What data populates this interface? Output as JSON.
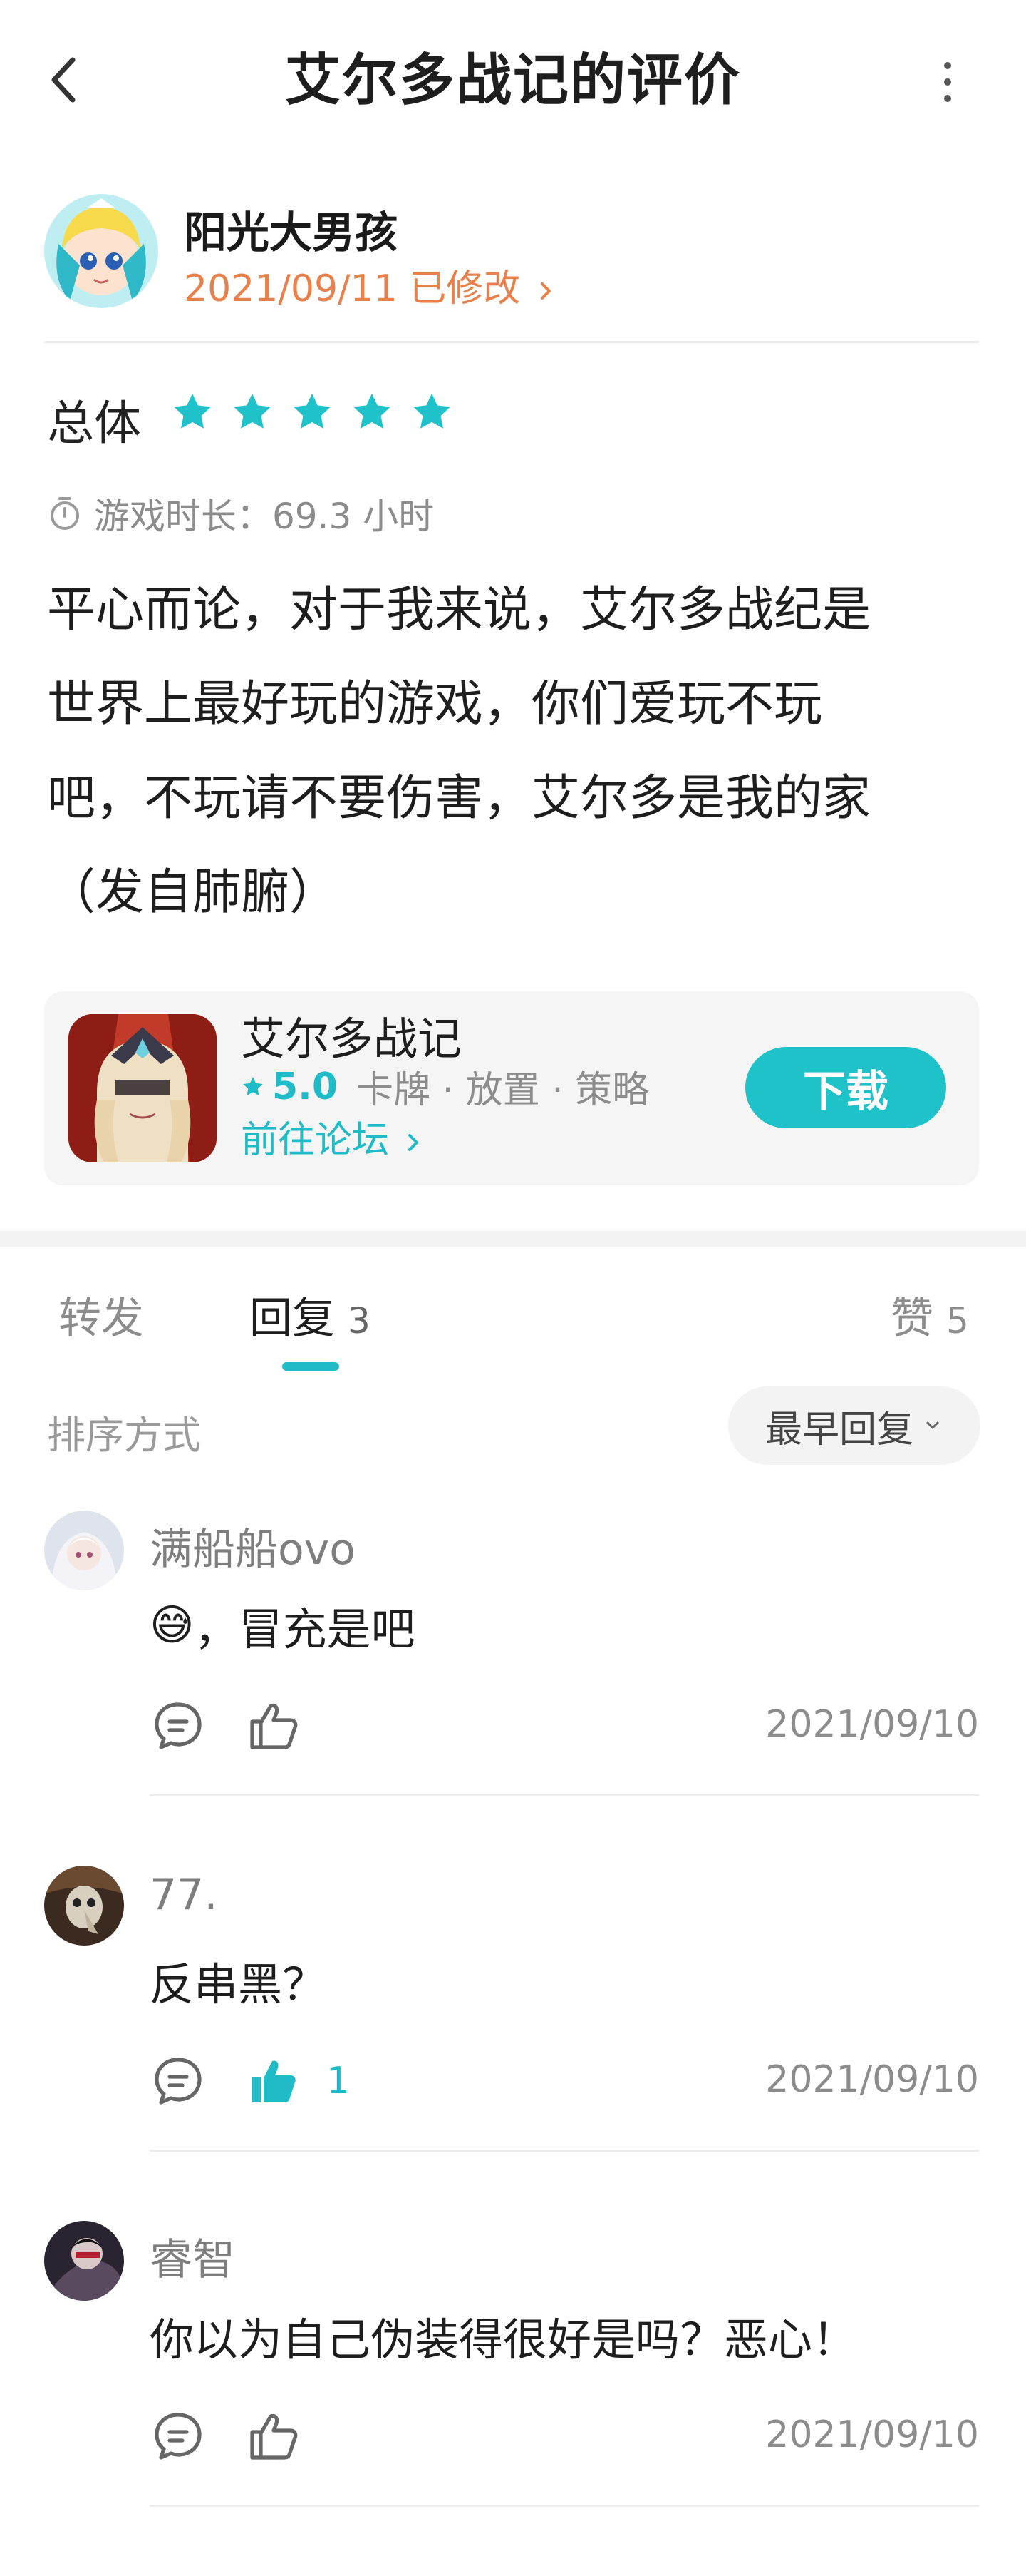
{
  "header": {
    "title": "艾尔多战记的评价"
  },
  "author": {
    "name": "阳光大男孩",
    "date": "2021/09/11 已修改"
  },
  "review": {
    "overall_label": "总体",
    "stars": 5,
    "playtime": "游戏时长：69.3 小时",
    "lines": [
      "平心而论，对于我来说，艾尔多战纪是",
      "世界上最好玩的游戏，你们爱玩不玩",
      "吧，不玩请不要伤害，艾尔多是我的家",
      "（发自肺腑）"
    ]
  },
  "game": {
    "name": "艾尔多战记",
    "rating": "5.0",
    "tags": "卡牌 · 放置 · 策略",
    "forum_link": "前往论坛",
    "download_label": "下载"
  },
  "tabs": [
    {
      "label": "转发",
      "count": ""
    },
    {
      "label": "回复",
      "count": "3"
    },
    {
      "label": "赞",
      "count": "5"
    }
  ],
  "sort": {
    "label": "排序方式",
    "selected": "最早回复"
  },
  "replies": [
    {
      "name": "满船船ovo",
      "emoji": "😅",
      "text": "，冒充是吧",
      "likes": "",
      "liked": false,
      "date": "2021/09/10"
    },
    {
      "name": "77.",
      "emoji": "",
      "text": "反串黑？",
      "likes": "1",
      "liked": true,
      "date": "2021/09/10"
    },
    {
      "name": "睿智",
      "emoji": "",
      "text": "你以为自己伪装得很好是吗？恶心！",
      "likes": "",
      "liked": false,
      "date": "2021/09/10"
    }
  ],
  "colors": {
    "accent": "#1fbcc8",
    "date_orange": "#e8804b",
    "star": "#1fc2c9"
  },
  "icons": [
    "back-arrow-icon",
    "more-vertical-icon",
    "star-icon",
    "timer-icon",
    "comment-icon",
    "thumbs-up-icon",
    "chevron-right-icon",
    "chevron-down-icon"
  ]
}
